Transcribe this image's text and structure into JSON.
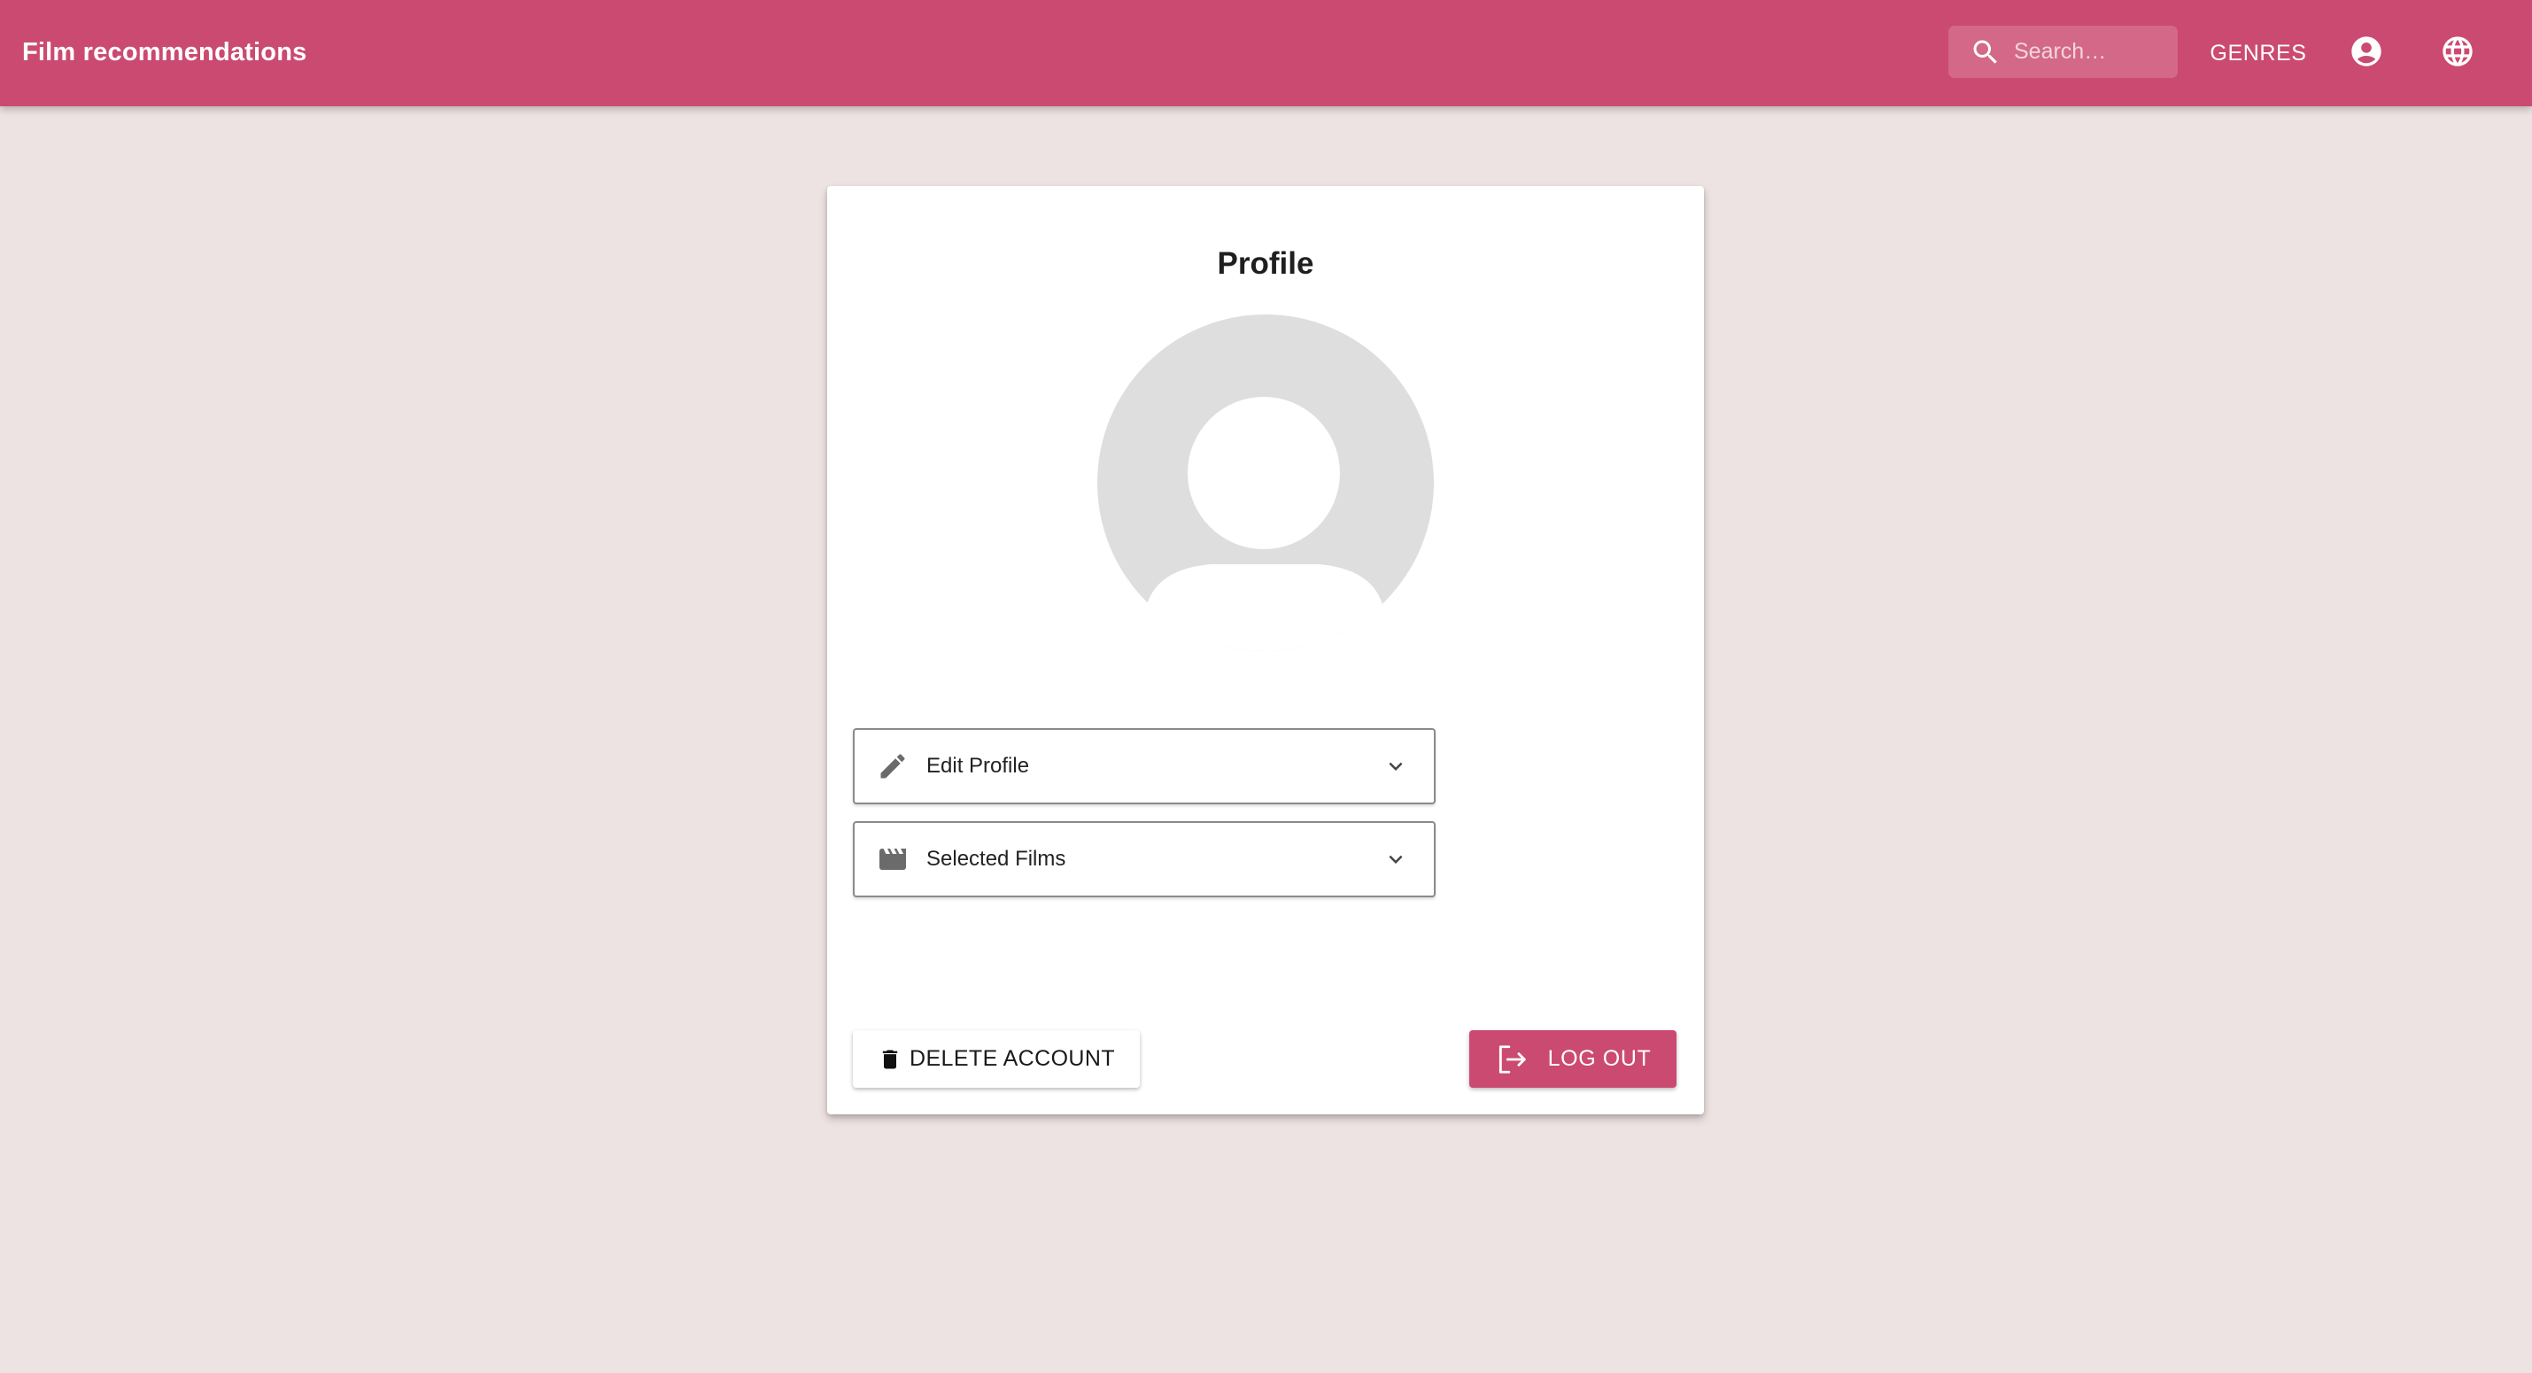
{
  "appbar": {
    "title": "Film recommendations",
    "search_placeholder": "Search…",
    "genres_label": "GENRES",
    "icons": {
      "search": "search-icon",
      "account": "account-circle-icon",
      "language": "globe-icon"
    }
  },
  "profile": {
    "title": "Profile",
    "avatar_icon": "default-avatar-icon",
    "sections": [
      {
        "label": "Edit Profile",
        "icon": "pencil-icon",
        "expanded": false
      },
      {
        "label": "Selected Films",
        "icon": "clapperboard-icon",
        "expanded": false
      }
    ],
    "delete_label": "DELETE ACCOUNT",
    "logout_label": "LOG OUT"
  },
  "colors": {
    "primary": "#cb4a72",
    "background": "#eee3e3",
    "card": "#ffffff",
    "avatar_gray": "#dedede"
  }
}
